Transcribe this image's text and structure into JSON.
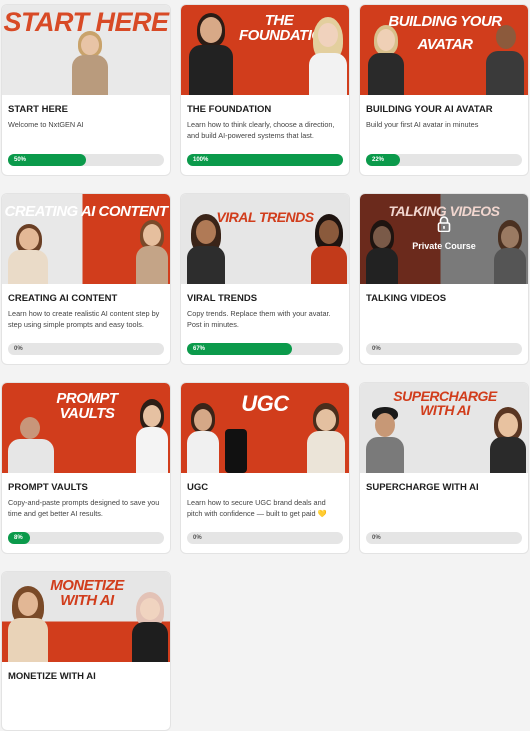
{
  "courses": [
    {
      "title": "START HERE",
      "banner": "START HERE",
      "desc": "Welcome to NxtGEN AI",
      "progress_label": "50%",
      "progress": 0.5,
      "bg": "#e8e8e8",
      "banner_color": "#d84a26"
    },
    {
      "title": "THE FOUNDATION",
      "banner": "THE FOUNDATION",
      "desc": "Learn how to think clearly, choose a direction, and build AI-powered systems that last.",
      "progress_label": "100%",
      "progress": 1.0,
      "bg": "#d13d1c",
      "banner_color": "#ffffff"
    },
    {
      "title": "BUILDING YOUR AI AVATAR",
      "banner": "BUILDING YOUR AVATAR",
      "desc": "Build your first AI avatar in minutes",
      "progress_label": "22%",
      "progress": 0.22,
      "bg": "#d13d1c",
      "banner_color": "#ffffff"
    },
    {
      "title": "CREATING AI CONTENT",
      "banner": "CREATING AI CONTENT",
      "desc": "Learn how to create realistic AI content step by step using simple prompts and easy tools.",
      "progress_label": "0%",
      "progress": 0,
      "bg": "#d13d1c",
      "banner_color": "#ffffff"
    },
    {
      "title": "VIRAL TRENDS",
      "banner": "VIRAL TRENDS",
      "desc": "Copy trends. Replace them with your avatar. Post in minutes.",
      "progress_label": "67%",
      "progress": 0.67,
      "bg": "#e4e4e4",
      "banner_color": "#d13d1c"
    },
    {
      "title": "TALKING VIDEOS",
      "banner": "TALKING VIDEOS",
      "desc": "",
      "progress_label": "0%",
      "progress": 0,
      "bg": "#6b2a1c",
      "banner_color": "#ffffff",
      "locked": true,
      "lock_text": "Private Course"
    },
    {
      "title": "PROMPT VAULTS",
      "banner": "PROMPT VAULTS",
      "desc": "Copy-and-paste prompts designed to save you time and get better AI results.",
      "progress_label": "8%",
      "progress": 0.08,
      "bg": "#d13d1c",
      "banner_color": "#ffffff"
    },
    {
      "title": "UGC",
      "banner": "UGC",
      "desc": "Learn how to secure UGC brand deals and pitch with confidence — built to get paid 💛",
      "progress_label": "0%",
      "progress": 0,
      "bg": "#d13d1c",
      "banner_color": "#ffffff"
    },
    {
      "title": "SUPERCHARGE WITH AI",
      "banner": "SUPERCHARGE WITH AI",
      "desc": "",
      "progress_label": "0%",
      "progress": 0,
      "bg": "#e4e4e4",
      "banner_color": "#d13d1c"
    },
    {
      "title": "MONETIZE WITH AI",
      "banner": "MONETIZE WITH AI",
      "desc": "",
      "progress_label": "",
      "progress": 0,
      "bg": "#e4e4e4",
      "banner_color": "#d13d1c"
    }
  ]
}
